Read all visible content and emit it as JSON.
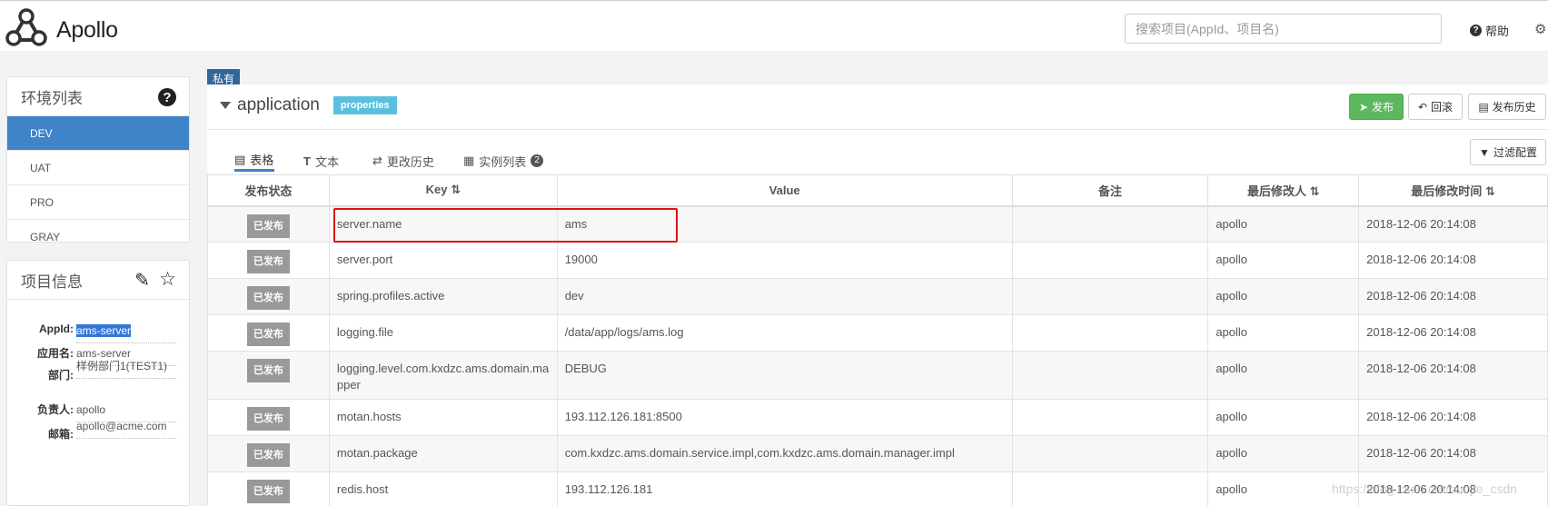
{
  "header": {
    "brand": "Apollo",
    "search_placeholder": "搜索项目(AppId、项目名)",
    "help_label": "帮助",
    "help_icon": "?",
    "gear_icon": "⚙"
  },
  "env_panel": {
    "title": "环境列表",
    "help_icon": "?",
    "items": [
      {
        "label": "DEV",
        "active": true
      },
      {
        "label": "UAT",
        "active": false
      },
      {
        "label": "PRO",
        "active": false
      },
      {
        "label": "GRAY",
        "active": false
      }
    ]
  },
  "project_panel": {
    "title": "项目信息",
    "edit_icon": "✎",
    "star_icon": "☆",
    "rows": [
      {
        "key": "AppId:",
        "value": "ams-server"
      },
      {
        "key": "应用名:",
        "value": "ams-server"
      },
      {
        "key": "部门:",
        "value": "样例部门1(TEST1)"
      },
      {
        "key": "负责人:",
        "value": "apollo"
      },
      {
        "key": "邮箱:",
        "value": "apollo@acme.com"
      }
    ]
  },
  "namespace": {
    "private_tag": "私有",
    "name": "application",
    "format": "properties",
    "actions": {
      "publish": "发布",
      "rollback": "回滚",
      "history": "发布历史",
      "filter": "过滤配置"
    },
    "tabs": [
      {
        "label": "表格",
        "icon": "▤"
      },
      {
        "label": "文本",
        "icon": "T"
      },
      {
        "label": "更改历史",
        "icon": "⇄"
      },
      {
        "label": "实例列表",
        "icon": "▦",
        "count": "2"
      }
    ]
  },
  "table": {
    "headers": {
      "status": "发布状态",
      "key": "Key",
      "value": "Value",
      "comment": "备注",
      "modifier": "最后修改人",
      "time": "最后修改时间"
    },
    "sort_icon": "⇅",
    "rows": [
      {
        "status": "已发布",
        "key": "server.name",
        "value": "ams",
        "comment": "",
        "modifier": "apollo",
        "time": "2018-12-06 20:14:08"
      },
      {
        "status": "已发布",
        "key": "server.port",
        "value": "19000",
        "comment": "",
        "modifier": "apollo",
        "time": "2018-12-06 20:14:08"
      },
      {
        "status": "已发布",
        "key": "spring.profiles.active",
        "value": "dev",
        "comment": "",
        "modifier": "apollo",
        "time": "2018-12-06 20:14:08"
      },
      {
        "status": "已发布",
        "key": "logging.file",
        "value": "/data/app/logs/ams.log",
        "comment": "",
        "modifier": "apollo",
        "time": "2018-12-06 20:14:08"
      },
      {
        "status": "已发布",
        "key": "logging.level.com.kxdzc.ams.domain.mapper",
        "value": "DEBUG",
        "comment": "",
        "modifier": "apollo",
        "time": "2018-12-06 20:14:08"
      },
      {
        "status": "已发布",
        "key": "motan.hosts",
        "value": "193.112.126.181:8500",
        "comment": "",
        "modifier": "apollo",
        "time": "2018-12-06 20:14:08"
      },
      {
        "status": "已发布",
        "key": "motan.package",
        "value": "com.kxdzc.ams.domain.service.impl,com.kxdzc.ams.domain.manager.impl",
        "comment": "",
        "modifier": "apollo",
        "time": "2018-12-06 20:14:08"
      },
      {
        "status": "已发布",
        "key": "redis.host",
        "value": "193.112.126.181",
        "comment": "",
        "modifier": "apollo",
        "time": "2018-12-06 20:14:08"
      }
    ]
  },
  "watermark": "https://blog.csdn.net/huojie_csdn"
}
